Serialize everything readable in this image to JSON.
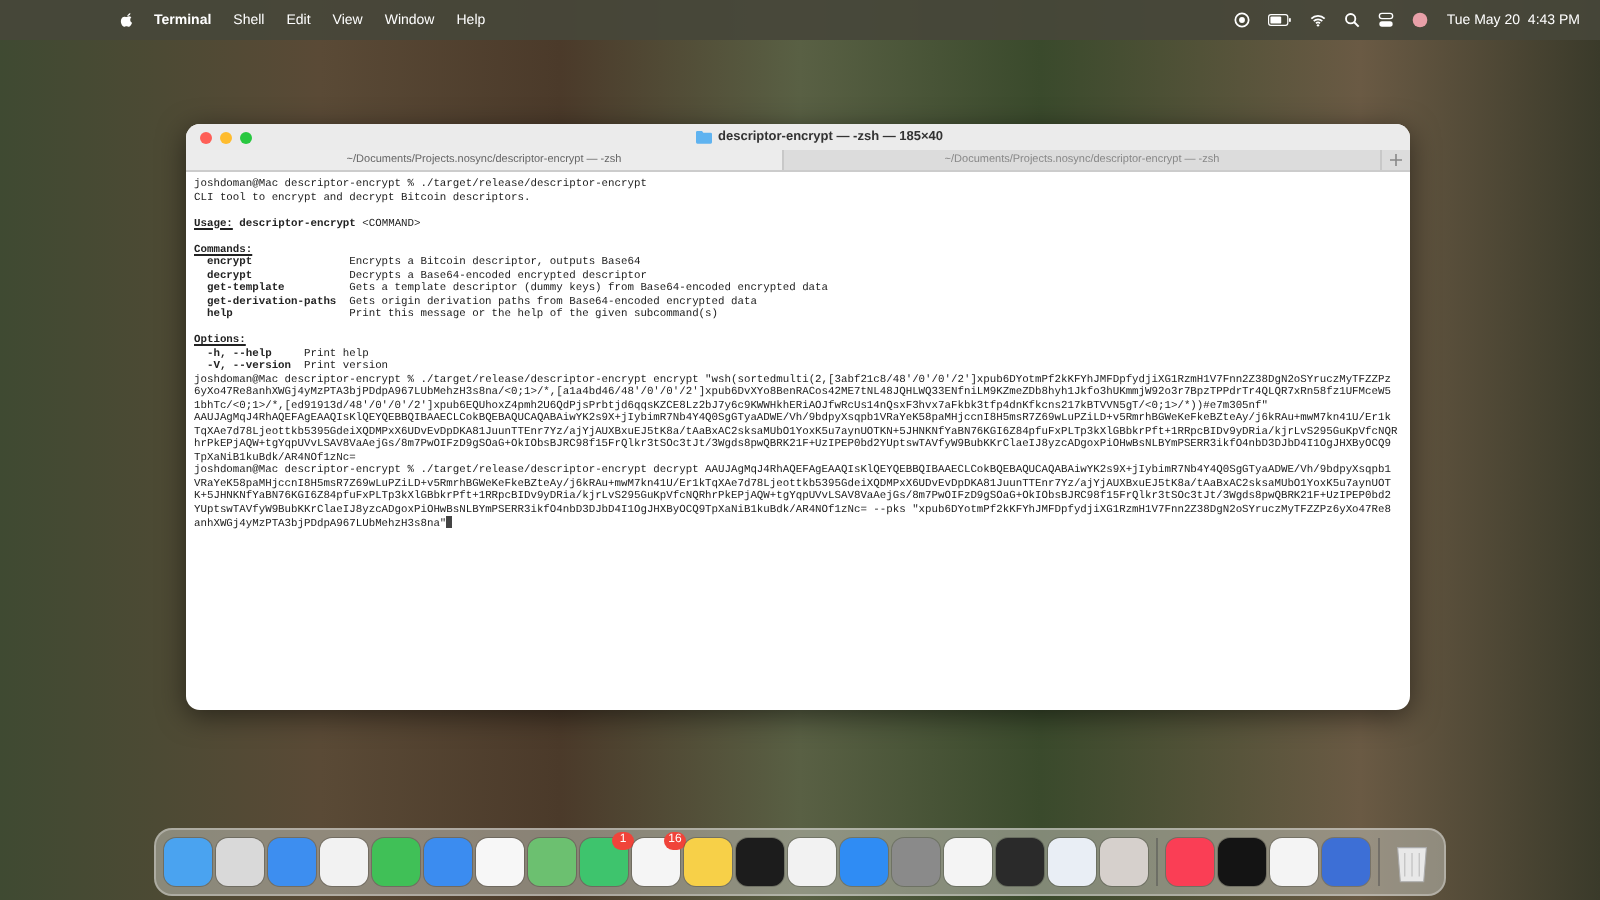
{
  "menu_bar": {
    "app_name": "Terminal",
    "menus": [
      "Shell",
      "Edit",
      "View",
      "Window",
      "Help"
    ],
    "clock": "Tue May 20  4:43 PM"
  },
  "window": {
    "title": "descriptor-encrypt — -zsh — 185×40",
    "tabs": [
      {
        "label": "~/Documents/Projects.nosync/descriptor-encrypt — -zsh",
        "selected": true
      },
      {
        "label": "~/Documents/Projects.nosync/descriptor-encrypt — -zsh",
        "selected": false
      }
    ],
    "cursor": true,
    "lines": [
      {
        "kind": "text",
        "text": "joshdoman@Mac descriptor-encrypt % ./target/release/descriptor-encrypt"
      },
      {
        "kind": "text",
        "text": "CLI tool to encrypt and decrypt Bitcoin descriptors."
      },
      {
        "kind": "usage",
        "label": "Usage:",
        "text": "**descriptor-encrypt** <COMMAND>"
      },
      {
        "kind": "heading",
        "text": "Commands:"
      },
      {
        "kind": "command",
        "name": "encrypt",
        "desc": "Encrypts a Bitcoin descriptor, outputs Base64"
      },
      {
        "kind": "command",
        "name": "decrypt",
        "desc": "Decrypts a Base64-encoded encrypted descriptor"
      },
      {
        "kind": "command",
        "name": "get-template",
        "desc": "Gets a template descriptor (dummy keys) from Base64-encoded encrypted data"
      },
      {
        "kind": "command",
        "name": "get-derivation-paths",
        "desc": "Gets origin derivation paths from Base64-encoded encrypted data"
      },
      {
        "kind": "command",
        "name": "help",
        "desc": "Print this message or the help of the given subcommand(s)"
      },
      {
        "kind": "heading",
        "text": "Options:"
      },
      {
        "kind": "option",
        "name": "-h, --help",
        "desc": "Print help"
      },
      {
        "kind": "option",
        "name": "-V, --version",
        "desc": "Print version"
      },
      {
        "kind": "text",
        "text": "joshdoman@Mac descriptor-encrypt % ./target/release/descriptor-encrypt encrypt \"wsh(sortedmulti(2,[3abf21c8/48'/0'/0'/2']xpub6DYotmPf2kKFYhJMFDpfydjiXG1RzmH1V7Fnn2Z38DgN2oSYruczMyTFZZPz"
      },
      {
        "kind": "text",
        "text": "6yXo47Re8anhXWGj4yMzPTA3bjPDdpA967LUbMehzH3s8na/<0;1>/*,[a1a4bd46/48'/0'/0'/2']xpub6DvXYo8BenRACos42ME7tNL48JQHLWQ33ENfniLM9KZmeZDb8hyh1Jkfo3hUKmmjW92o3r7BpzTPPdrTr4QLQR7xRn58fz1UFMceW5"
      },
      {
        "kind": "text",
        "text": "1bhTc/<0;1>/*,[ed91913d/48'/0'/0'/2']xpub6EQUhoxZ4pmh2U6QdPjsPrbtjd6qqsKZCE8Lz2bJ7y6c9KWWHkhERiAOJfwRcUs14nQsxF3hvx7aFkbk3tfp4dnKfkcns217kBTVVN5gT/<0;1>/*))#e7m305nf\""
      },
      {
        "kind": "text",
        "text": "AAUJAgMqJ4RhAQEFAgEAAQIsKlQEYQEBBQIBAAECLCokBQEBAQUCAQABAiwYK2s9X+jIybimR7Nb4Y4Q0SgGTyaADWE/Vh/9bdpyXsqpb1VRaYeK58paMHjccnI8H5msR7Z69wLuPZiLD+v5RmrhBGWeKeFkeBZteAy/j6kRAu+mwM7kn41U/Er1k"
      },
      {
        "kind": "text",
        "text": "TqXAe7d78Ljeottkb5395GdeiXQDMPxX6UDvEvDpDKA81JuunTTEnr7Yz/ajYjAUXBxuEJ5tK8a/tAaBxAC2sksaMUbO1YoxK5u7aynUOTKN+5JHNKNfYaBN76KGI6Z84pfuFxPLTp3kXlGBbkrPft+1RRpcBIDv9yDRia/kjrLvS295GuKpVfcNQR"
      },
      {
        "kind": "text",
        "text": "hrPkEPjAQW+tgYqpUVvLSAV8VaAejGs/8m7PwOIFzD9gSOaG+OkIObsBJRC98f15FrQlkr3tSOc3tJt/3Wgds8pwQBRK21F+UzIPEP0bd2YUptswTAVfyW9BubKKrClaeIJ8yzcADgoxPiOHwBsNLBYmPSERR3ikfO4nbD3DJbD4I1OgJHXByOCQ9"
      },
      {
        "kind": "text",
        "text": "TpXaNiB1kuBdk/AR4NOf1zNc="
      },
      {
        "kind": "text",
        "text": "joshdoman@Mac descriptor-encrypt % ./target/release/descriptor-encrypt decrypt AAUJAgMqJ4RhAQEFAgEAAQIsKlQEYQEBBQIBAAECLCokBQEBAQUCAQABAiwYK2s9X+jIybimR7Nb4Y4Q0SgGTyaADWE/Vh/9bdpyXsqpb1"
      },
      {
        "kind": "text",
        "text": "VRaYeK58paMHjccnI8H5msR7Z69wLuPZiLD+v5RmrhBGWeKeFkeBZteAy/j6kRAu+mwM7kn41U/Er1kTqXAe7d78Ljeottkb5395GdeiXQDMPxX6UDvEvDpDKA81JuunTTEnr7Yz/ajYjAUXBxuEJ5tK8a/tAaBxAC2sksaMUbO1YoxK5u7aynUOT"
      },
      {
        "kind": "text",
        "text": "K+5JHNKNfYaBN76KGI6Z84pfuFxPLTp3kXlGBbkrPft+1RRpcBIDv9yDRia/kjrLvS295GuKpVfcNQRhrPkEPjAQW+tgYqpUVvLSAV8VaAejGs/8m7PwOIFzD9gSOaG+OkIObsBJRC98f15FrQlkr3tSOc3tJt/3Wgds8pwQBRK21F+UzIPEP0bd2"
      },
      {
        "kind": "text",
        "text": "YUptswTAVfyW9BubKKrClaeIJ8yzcADgoxPiOHwBsNLBYmPSERR3ikfO4nbD3DJbD4I1OgJHXByOCQ9TpXaNiB1kuBdk/AR4NOf1zNc= --pks \"xpub6DYotmPf2kKFYhJMFDpfydjiXG1RzmH1V7Fnn2Z38DgN2oSYruczMyTFZZPz6yXo47Re8"
      },
      {
        "kind": "text",
        "text": "anhXWGj4yMzPTA3bjPDdpA967LUbMehzH3s8na\""
      }
    ]
  },
  "dock": {
    "items": [
      {
        "kind": "app"
      },
      {
        "kind": "app"
      },
      {
        "kind": "app"
      },
      {
        "kind": "app"
      },
      {
        "kind": "app"
      },
      {
        "kind": "app"
      },
      {
        "kind": "app"
      },
      {
        "kind": "app"
      },
      {
        "kind": "app",
        "badge": "1"
      },
      {
        "kind": "app",
        "badge": "16"
      },
      {
        "kind": "app"
      },
      {
        "kind": "app"
      },
      {
        "kind": "app"
      },
      {
        "kind": "app"
      },
      {
        "kind": "app"
      },
      {
        "kind": "app"
      },
      {
        "kind": "app"
      },
      {
        "kind": "app"
      },
      {
        "kind": "app"
      },
      {
        "kind": "separator"
      },
      {
        "kind": "app"
      },
      {
        "kind": "app"
      },
      {
        "kind": "app"
      },
      {
        "kind": "app"
      },
      {
        "kind": "separator"
      },
      {
        "kind": "trash"
      }
    ]
  }
}
